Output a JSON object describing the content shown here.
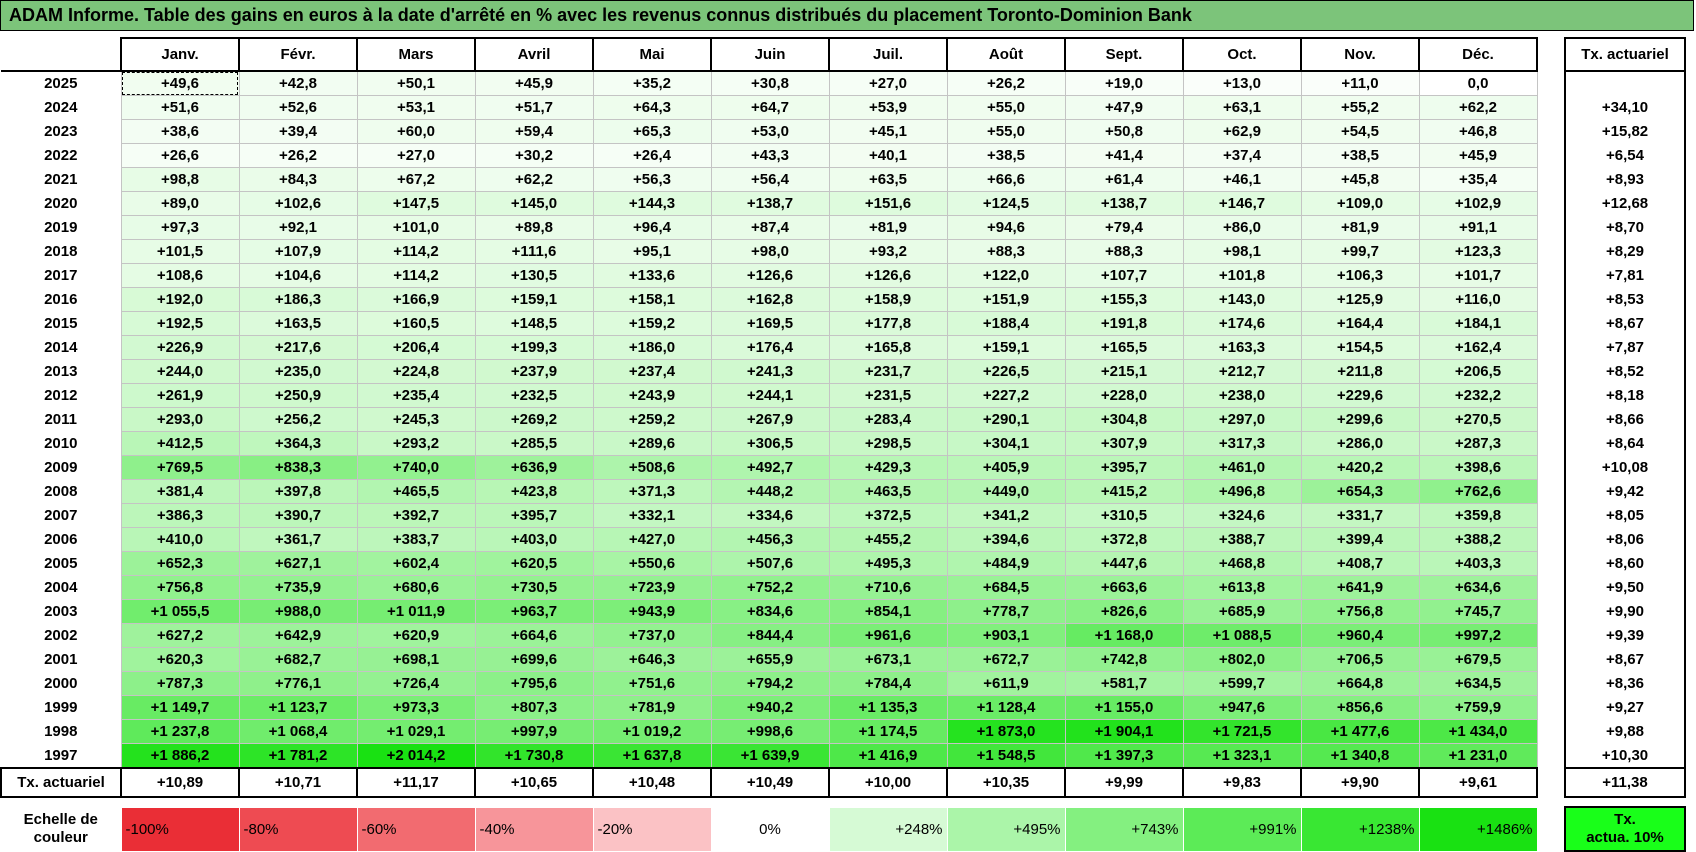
{
  "title": "ADAM Informe. Table des gains en euros à la date d'arrêté en % avec les revenus connus distribués du placement Toronto-Dominion Bank",
  "months": [
    "Janv.",
    "Févr.",
    "Mars",
    "Avril",
    "Mai",
    "Juin",
    "Juil.",
    "Août",
    "Sept.",
    "Oct.",
    "Nov.",
    "Déc."
  ],
  "rate_header": "Tx. actuariel",
  "rows": [
    {
      "year": "2025",
      "values": [
        "+49,6",
        "+42,8",
        "+50,1",
        "+45,9",
        "+35,2",
        "+30,8",
        "+27,0",
        "+26,2",
        "+19,0",
        "+13,0",
        "+11,0",
        "0,0"
      ],
      "rate": ""
    },
    {
      "year": "2024",
      "values": [
        "+51,6",
        "+52,6",
        "+53,1",
        "+51,7",
        "+64,3",
        "+64,7",
        "+53,9",
        "+55,0",
        "+47,9",
        "+63,1",
        "+55,2",
        "+62,2"
      ],
      "rate": "+34,10"
    },
    {
      "year": "2023",
      "values": [
        "+38,6",
        "+39,4",
        "+60,0",
        "+59,4",
        "+65,3",
        "+53,0",
        "+45,1",
        "+55,0",
        "+50,8",
        "+62,9",
        "+54,5",
        "+46,8"
      ],
      "rate": "+15,82"
    },
    {
      "year": "2022",
      "values": [
        "+26,6",
        "+26,2",
        "+27,0",
        "+30,2",
        "+26,4",
        "+43,3",
        "+40,1",
        "+38,5",
        "+41,4",
        "+37,4",
        "+38,5",
        "+45,9"
      ],
      "rate": "+6,54"
    },
    {
      "year": "2021",
      "values": [
        "+98,8",
        "+84,3",
        "+67,2",
        "+62,2",
        "+56,3",
        "+56,4",
        "+63,5",
        "+66,6",
        "+61,4",
        "+46,1",
        "+45,8",
        "+35,4"
      ],
      "rate": "+8,93"
    },
    {
      "year": "2020",
      "values": [
        "+89,0",
        "+102,6",
        "+147,5",
        "+145,0",
        "+144,3",
        "+138,7",
        "+151,6",
        "+124,5",
        "+138,7",
        "+146,7",
        "+109,0",
        "+102,9"
      ],
      "rate": "+12,68"
    },
    {
      "year": "2019",
      "values": [
        "+97,3",
        "+92,1",
        "+101,0",
        "+89,8",
        "+96,4",
        "+87,4",
        "+81,9",
        "+94,6",
        "+79,4",
        "+86,0",
        "+81,9",
        "+91,1"
      ],
      "rate": "+8,70"
    },
    {
      "year": "2018",
      "values": [
        "+101,5",
        "+107,9",
        "+114,2",
        "+111,6",
        "+95,1",
        "+98,0",
        "+93,2",
        "+88,3",
        "+88,3",
        "+98,1",
        "+99,7",
        "+123,3"
      ],
      "rate": "+8,29"
    },
    {
      "year": "2017",
      "values": [
        "+108,6",
        "+104,6",
        "+114,2",
        "+130,5",
        "+133,6",
        "+126,6",
        "+126,6",
        "+122,0",
        "+107,7",
        "+101,8",
        "+106,3",
        "+101,7"
      ],
      "rate": "+7,81"
    },
    {
      "year": "2016",
      "values": [
        "+192,0",
        "+186,3",
        "+166,9",
        "+159,1",
        "+158,1",
        "+162,8",
        "+158,9",
        "+151,9",
        "+155,3",
        "+143,0",
        "+125,9",
        "+116,0"
      ],
      "rate": "+8,53"
    },
    {
      "year": "2015",
      "values": [
        "+192,5",
        "+163,5",
        "+160,5",
        "+148,5",
        "+159,2",
        "+169,5",
        "+177,8",
        "+188,4",
        "+191,8",
        "+174,6",
        "+164,4",
        "+184,1"
      ],
      "rate": "+8,67"
    },
    {
      "year": "2014",
      "values": [
        "+226,9",
        "+217,6",
        "+206,4",
        "+199,3",
        "+186,0",
        "+176,4",
        "+165,8",
        "+159,1",
        "+165,5",
        "+163,3",
        "+154,5",
        "+162,4"
      ],
      "rate": "+7,87"
    },
    {
      "year": "2013",
      "values": [
        "+244,0",
        "+235,0",
        "+224,8",
        "+237,9",
        "+237,4",
        "+241,3",
        "+231,7",
        "+226,5",
        "+215,1",
        "+212,7",
        "+211,8",
        "+206,5"
      ],
      "rate": "+8,52"
    },
    {
      "year": "2012",
      "values": [
        "+261,9",
        "+250,9",
        "+235,4",
        "+232,5",
        "+243,9",
        "+244,1",
        "+231,5",
        "+227,2",
        "+228,0",
        "+238,0",
        "+229,6",
        "+232,2"
      ],
      "rate": "+8,18"
    },
    {
      "year": "2011",
      "values": [
        "+293,0",
        "+256,2",
        "+245,3",
        "+269,2",
        "+259,2",
        "+267,9",
        "+283,4",
        "+290,1",
        "+304,8",
        "+297,0",
        "+299,6",
        "+270,5"
      ],
      "rate": "+8,66"
    },
    {
      "year": "2010",
      "values": [
        "+412,5",
        "+364,3",
        "+293,2",
        "+285,5",
        "+289,6",
        "+306,5",
        "+298,5",
        "+304,1",
        "+307,9",
        "+317,3",
        "+286,0",
        "+287,3"
      ],
      "rate": "+8,64"
    },
    {
      "year": "2009",
      "values": [
        "+769,5",
        "+838,3",
        "+740,0",
        "+636,9",
        "+508,6",
        "+492,7",
        "+429,3",
        "+405,9",
        "+395,7",
        "+461,0",
        "+420,2",
        "+398,6"
      ],
      "rate": "+10,08"
    },
    {
      "year": "2008",
      "values": [
        "+381,4",
        "+397,8",
        "+465,5",
        "+423,8",
        "+371,3",
        "+448,2",
        "+463,5",
        "+449,0",
        "+415,2",
        "+496,8",
        "+654,3",
        "+762,6"
      ],
      "rate": "+9,42"
    },
    {
      "year": "2007",
      "values": [
        "+386,3",
        "+390,7",
        "+392,7",
        "+395,7",
        "+332,1",
        "+334,6",
        "+372,5",
        "+341,2",
        "+310,5",
        "+324,6",
        "+331,7",
        "+359,8"
      ],
      "rate": "+8,05"
    },
    {
      "year": "2006",
      "values": [
        "+410,0",
        "+361,7",
        "+383,7",
        "+403,0",
        "+427,0",
        "+456,3",
        "+455,2",
        "+394,6",
        "+372,8",
        "+388,7",
        "+399,4",
        "+388,2"
      ],
      "rate": "+8,06"
    },
    {
      "year": "2005",
      "values": [
        "+652,3",
        "+627,1",
        "+602,4",
        "+620,5",
        "+550,6",
        "+507,6",
        "+495,3",
        "+484,9",
        "+447,6",
        "+468,8",
        "+408,7",
        "+403,3"
      ],
      "rate": "+8,60"
    },
    {
      "year": "2004",
      "values": [
        "+756,8",
        "+735,9",
        "+680,6",
        "+730,5",
        "+723,9",
        "+752,2",
        "+710,6",
        "+684,5",
        "+663,6",
        "+613,8",
        "+641,9",
        "+634,6"
      ],
      "rate": "+9,50"
    },
    {
      "year": "2003",
      "values": [
        "+1 055,5",
        "+988,0",
        "+1 011,9",
        "+963,7",
        "+943,9",
        "+834,6",
        "+854,1",
        "+778,7",
        "+826,6",
        "+685,9",
        "+756,8",
        "+745,7"
      ],
      "rate": "+9,90"
    },
    {
      "year": "2002",
      "values": [
        "+627,2",
        "+642,9",
        "+620,9",
        "+664,6",
        "+737,0",
        "+844,4",
        "+961,6",
        "+903,1",
        "+1 168,0",
        "+1 088,5",
        "+960,4",
        "+997,2"
      ],
      "rate": "+9,39"
    },
    {
      "year": "2001",
      "values": [
        "+620,3",
        "+682,7",
        "+698,1",
        "+699,6",
        "+646,3",
        "+655,9",
        "+673,1",
        "+672,7",
        "+742,8",
        "+802,0",
        "+706,5",
        "+679,5"
      ],
      "rate": "+8,67"
    },
    {
      "year": "2000",
      "values": [
        "+787,3",
        "+776,1",
        "+726,4",
        "+795,6",
        "+751,6",
        "+794,2",
        "+784,4",
        "+611,9",
        "+581,7",
        "+599,7",
        "+664,8",
        "+634,5"
      ],
      "rate": "+8,36"
    },
    {
      "year": "1999",
      "values": [
        "+1 149,7",
        "+1 123,7",
        "+973,3",
        "+807,3",
        "+781,9",
        "+940,2",
        "+1 135,3",
        "+1 128,4",
        "+1 155,0",
        "+947,6",
        "+856,6",
        "+759,9"
      ],
      "rate": "+9,27"
    },
    {
      "year": "1998",
      "values": [
        "+1 237,8",
        "+1 068,4",
        "+1 029,1",
        "+997,9",
        "+1 019,2",
        "+998,6",
        "+1 174,5",
        "+1 873,0",
        "+1 904,1",
        "+1 721,5",
        "+1 477,6",
        "+1 434,0"
      ],
      "rate": "+9,88"
    },
    {
      "year": "1997",
      "values": [
        "+1 886,2",
        "+1 781,2",
        "+2 014,2",
        "+1 730,8",
        "+1 637,8",
        "+1 639,9",
        "+1 416,9",
        "+1 548,5",
        "+1 397,3",
        "+1 323,1",
        "+1 340,8",
        "+1 231,0"
      ],
      "rate": "+10,30"
    }
  ],
  "footer": {
    "label": "Tx. actuariel",
    "values": [
      "+10,89",
      "+10,71",
      "+11,17",
      "+10,65",
      "+10,48",
      "+10,49",
      "+10,00",
      "+10,35",
      "+9,99",
      "+9,83",
      "+9,90",
      "+9,61"
    ],
    "rate": "+11,38"
  },
  "scale": {
    "label_line1": "Echelle de",
    "label_line2": "couleur",
    "steps": [
      {
        "text": "-100%",
        "color": "#ea2e36"
      },
      {
        "text": "-80%",
        "color": "#ee4b52"
      },
      {
        "text": "-60%",
        "color": "#f26b70"
      },
      {
        "text": "-40%",
        "color": "#f7959a"
      },
      {
        "text": "-20%",
        "color": "#fbc2c5"
      },
      {
        "text": "0%",
        "color": "#ffffff"
      },
      {
        "text": "+248%",
        "color": "#d6fad5"
      },
      {
        "text": "+495%",
        "color": "#abf5a9"
      },
      {
        "text": "+743%",
        "color": "#84f080"
      },
      {
        "text": "+991%",
        "color": "#5ceb57"
      },
      {
        "text": "+1238%",
        "color": "#39e733"
      },
      {
        "text": "+1486%",
        "color": "#19e112"
      }
    ],
    "rate_line1": "Tx.",
    "rate_line2": "actua. 10%"
  },
  "colors": {
    "title_bg": "#7cc47a",
    "scale_max": "#19e112",
    "zero": "#ffffff",
    "rate_legend_bg": "#19ff19"
  }
}
